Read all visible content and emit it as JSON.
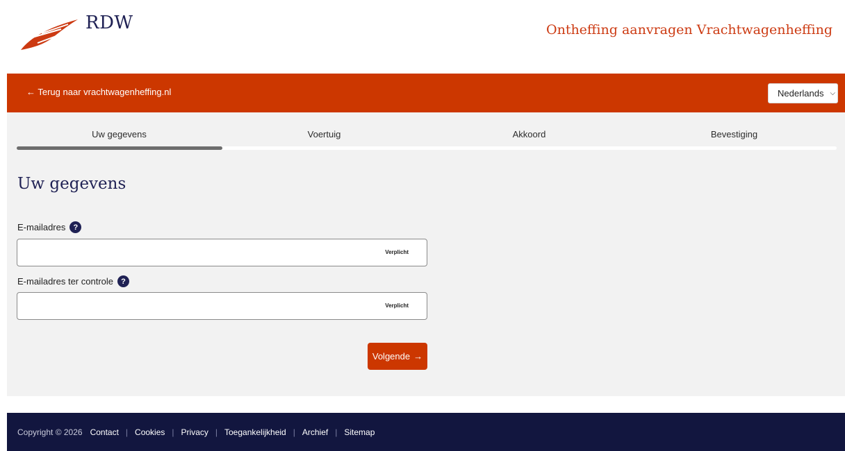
{
  "header": {
    "logo_text": "RDW",
    "app_title": "Ontheffing aanvragen Vrachtwagenheffing",
    "logo_color": "#cc3a12"
  },
  "nav": {
    "back_link": "← Terug naar vrachtwagenheffing.nl",
    "language": "Nederlands",
    "accent_color": "#cc3700"
  },
  "steps": [
    "Uw gegevens",
    "Voertuig",
    "Akkoord",
    "Bevestiging"
  ],
  "active_step": 0,
  "form": {
    "title": "Uw gegevens",
    "email_label": "E-mailadres",
    "email_value": "",
    "email_required": "Verplicht",
    "email_confirm_label": "E-mailadres ter controle",
    "email_confirm_value": "",
    "email_confirm_required": "Verplicht",
    "help_symbol": "?",
    "next_label": "Volgende",
    "next_arrow": "→"
  },
  "footer": {
    "copyright": "Copyright © 2026",
    "links": [
      "Contact",
      "Cookies",
      "Privacy",
      "Toegankelijkheid",
      "Archief",
      "Sitemap"
    ],
    "background_color": "#12163f"
  }
}
